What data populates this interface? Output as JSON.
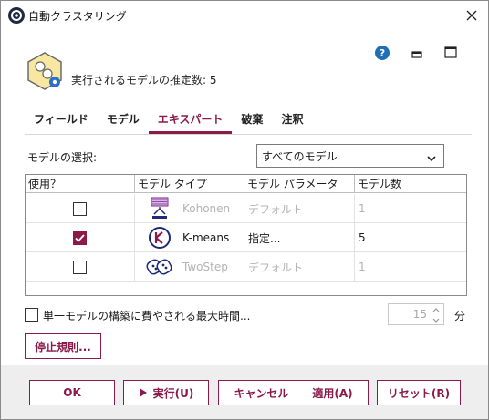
{
  "window": {
    "title": "自動クラスタリング",
    "estimate_label": "実行されるモデルの推定数: 5"
  },
  "tabs": [
    {
      "label": "フィールド",
      "active": false
    },
    {
      "label": "モデル",
      "active": false
    },
    {
      "label": "エキスパート",
      "active": true
    },
    {
      "label": "破棄",
      "active": false
    },
    {
      "label": "注釈",
      "active": false
    }
  ],
  "model_select": {
    "label": "モデルの選択:",
    "value": "すべてのモデル"
  },
  "grid": {
    "headers": [
      "使用？",
      "モデル タイプ",
      "モデル パラメータ",
      "モデル数"
    ],
    "rows": [
      {
        "use": false,
        "type": "Kohonen",
        "param": "デフォルト",
        "count": "1",
        "icon": "kohonen-icon"
      },
      {
        "use": true,
        "type": "K-means",
        "param": "指定...",
        "count": "5",
        "icon": "kmeans-icon"
      },
      {
        "use": false,
        "type": "TwoStep",
        "param": "デフォルト",
        "count": "1",
        "icon": "twostep-icon"
      }
    ]
  },
  "max_time": {
    "label": "単一モデルの構築に費やされる最大時間...",
    "value": "15",
    "unit": "分"
  },
  "buttons": {
    "stop": "停止規則...",
    "ok": "OK",
    "run": "実行(U)",
    "cancel": "キャンセル",
    "apply": "適用(A)",
    "reset": "リセット(R)"
  },
  "colors": {
    "accent": "#8b1a4a",
    "footer_bg": "#eeeeee",
    "help_blue": "#1f6fb5"
  }
}
